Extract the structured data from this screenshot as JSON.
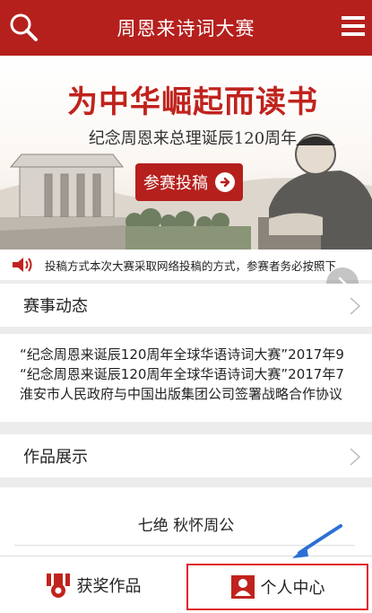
{
  "header": {
    "title": "周恩来诗词大赛",
    "search_icon": "search-icon",
    "menu_icon": "hamburger-menu-icon",
    "color": "#b5201d"
  },
  "banner": {
    "headline": "为中华崛起而读书",
    "subtitle": "纪念周恩来总理诞辰120周年",
    "cta_label": "参赛投稿"
  },
  "notice": {
    "text": "投稿方式本次大赛采取网络投稿的方式，参赛者务必按照下"
  },
  "news_section": {
    "title": "赛事动态",
    "items": [
      "“纪念周恩来诞辰120周年全球华语诗词大赛”2017年9",
      "“纪念周恩来诞辰120周年全球华语诗词大赛”2017年7",
      "淮安市人民政府与中国出版集团公司签署战略合作协议"
    ]
  },
  "works_section": {
    "title": "作品展示",
    "featured_poem": "七绝 秋怀周公"
  },
  "bottom_nav": {
    "tabs": [
      {
        "label": "获奖作品",
        "icon": "award-icon"
      },
      {
        "label": "个人中心",
        "icon": "profile-icon"
      }
    ],
    "highlight_color": "#e0242d"
  }
}
